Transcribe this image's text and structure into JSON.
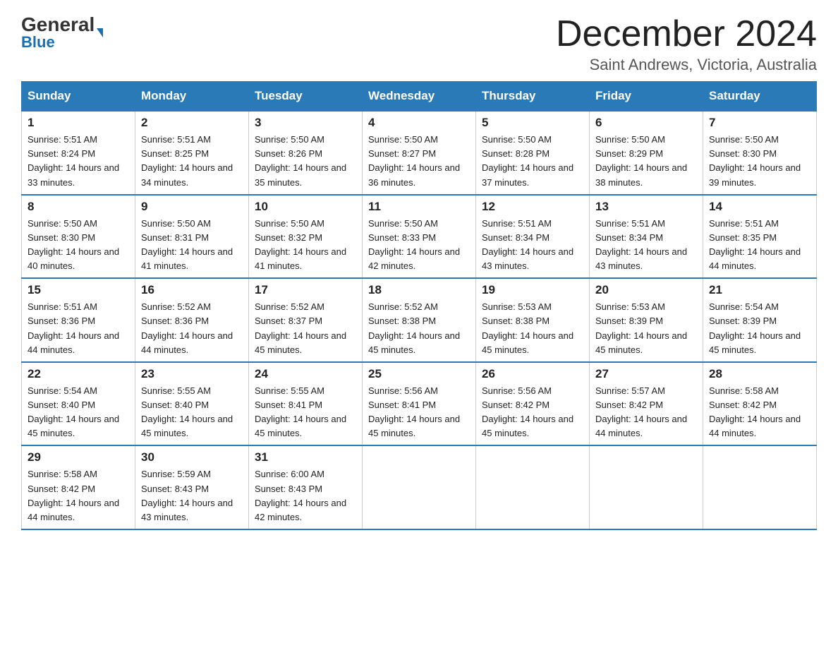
{
  "logo": {
    "general": "General",
    "triangle": "▶",
    "blue": "Blue"
  },
  "header": {
    "month_year": "December 2024",
    "location": "Saint Andrews, Victoria, Australia"
  },
  "days_of_week": [
    "Sunday",
    "Monday",
    "Tuesday",
    "Wednesday",
    "Thursday",
    "Friday",
    "Saturday"
  ],
  "weeks": [
    [
      {
        "day": "1",
        "sunrise": "5:51 AM",
        "sunset": "8:24 PM",
        "daylight": "14 hours and 33 minutes."
      },
      {
        "day": "2",
        "sunrise": "5:51 AM",
        "sunset": "8:25 PM",
        "daylight": "14 hours and 34 minutes."
      },
      {
        "day": "3",
        "sunrise": "5:50 AM",
        "sunset": "8:26 PM",
        "daylight": "14 hours and 35 minutes."
      },
      {
        "day": "4",
        "sunrise": "5:50 AM",
        "sunset": "8:27 PM",
        "daylight": "14 hours and 36 minutes."
      },
      {
        "day": "5",
        "sunrise": "5:50 AM",
        "sunset": "8:28 PM",
        "daylight": "14 hours and 37 minutes."
      },
      {
        "day": "6",
        "sunrise": "5:50 AM",
        "sunset": "8:29 PM",
        "daylight": "14 hours and 38 minutes."
      },
      {
        "day": "7",
        "sunrise": "5:50 AM",
        "sunset": "8:30 PM",
        "daylight": "14 hours and 39 minutes."
      }
    ],
    [
      {
        "day": "8",
        "sunrise": "5:50 AM",
        "sunset": "8:30 PM",
        "daylight": "14 hours and 40 minutes."
      },
      {
        "day": "9",
        "sunrise": "5:50 AM",
        "sunset": "8:31 PM",
        "daylight": "14 hours and 41 minutes."
      },
      {
        "day": "10",
        "sunrise": "5:50 AM",
        "sunset": "8:32 PM",
        "daylight": "14 hours and 41 minutes."
      },
      {
        "day": "11",
        "sunrise": "5:50 AM",
        "sunset": "8:33 PM",
        "daylight": "14 hours and 42 minutes."
      },
      {
        "day": "12",
        "sunrise": "5:51 AM",
        "sunset": "8:34 PM",
        "daylight": "14 hours and 43 minutes."
      },
      {
        "day": "13",
        "sunrise": "5:51 AM",
        "sunset": "8:34 PM",
        "daylight": "14 hours and 43 minutes."
      },
      {
        "day": "14",
        "sunrise": "5:51 AM",
        "sunset": "8:35 PM",
        "daylight": "14 hours and 44 minutes."
      }
    ],
    [
      {
        "day": "15",
        "sunrise": "5:51 AM",
        "sunset": "8:36 PM",
        "daylight": "14 hours and 44 minutes."
      },
      {
        "day": "16",
        "sunrise": "5:52 AM",
        "sunset": "8:36 PM",
        "daylight": "14 hours and 44 minutes."
      },
      {
        "day": "17",
        "sunrise": "5:52 AM",
        "sunset": "8:37 PM",
        "daylight": "14 hours and 45 minutes."
      },
      {
        "day": "18",
        "sunrise": "5:52 AM",
        "sunset": "8:38 PM",
        "daylight": "14 hours and 45 minutes."
      },
      {
        "day": "19",
        "sunrise": "5:53 AM",
        "sunset": "8:38 PM",
        "daylight": "14 hours and 45 minutes."
      },
      {
        "day": "20",
        "sunrise": "5:53 AM",
        "sunset": "8:39 PM",
        "daylight": "14 hours and 45 minutes."
      },
      {
        "day": "21",
        "sunrise": "5:54 AM",
        "sunset": "8:39 PM",
        "daylight": "14 hours and 45 minutes."
      }
    ],
    [
      {
        "day": "22",
        "sunrise": "5:54 AM",
        "sunset": "8:40 PM",
        "daylight": "14 hours and 45 minutes."
      },
      {
        "day": "23",
        "sunrise": "5:55 AM",
        "sunset": "8:40 PM",
        "daylight": "14 hours and 45 minutes."
      },
      {
        "day": "24",
        "sunrise": "5:55 AM",
        "sunset": "8:41 PM",
        "daylight": "14 hours and 45 minutes."
      },
      {
        "day": "25",
        "sunrise": "5:56 AM",
        "sunset": "8:41 PM",
        "daylight": "14 hours and 45 minutes."
      },
      {
        "day": "26",
        "sunrise": "5:56 AM",
        "sunset": "8:42 PM",
        "daylight": "14 hours and 45 minutes."
      },
      {
        "day": "27",
        "sunrise": "5:57 AM",
        "sunset": "8:42 PM",
        "daylight": "14 hours and 44 minutes."
      },
      {
        "day": "28",
        "sunrise": "5:58 AM",
        "sunset": "8:42 PM",
        "daylight": "14 hours and 44 minutes."
      }
    ],
    [
      {
        "day": "29",
        "sunrise": "5:58 AM",
        "sunset": "8:42 PM",
        "daylight": "14 hours and 44 minutes."
      },
      {
        "day": "30",
        "sunrise": "5:59 AM",
        "sunset": "8:43 PM",
        "daylight": "14 hours and 43 minutes."
      },
      {
        "day": "31",
        "sunrise": "6:00 AM",
        "sunset": "8:43 PM",
        "daylight": "14 hours and 42 minutes."
      },
      null,
      null,
      null,
      null
    ]
  ]
}
